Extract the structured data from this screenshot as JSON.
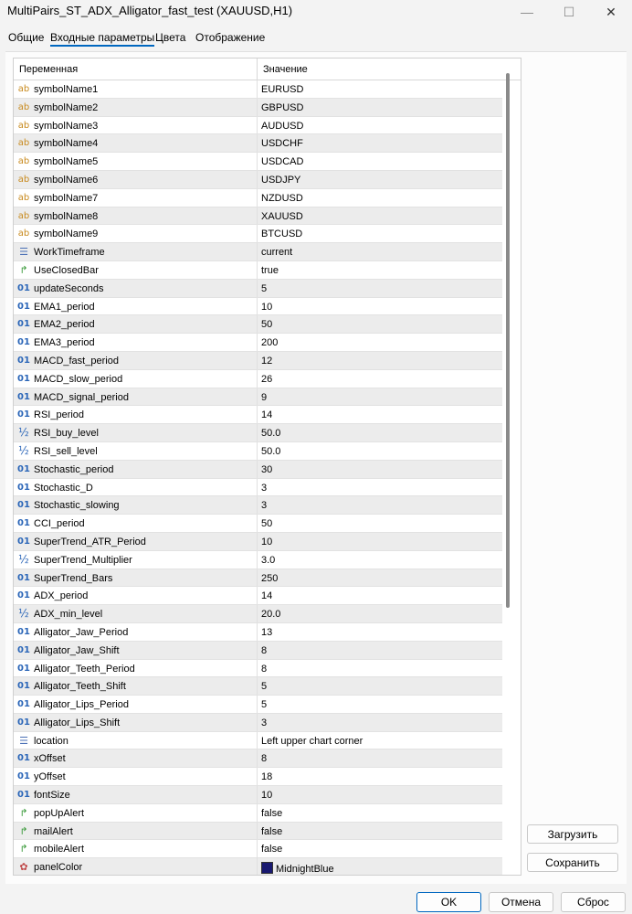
{
  "window": {
    "title": "MultiPairs_ST_ADX_Alligator_fast_test (XAUUSD,H1)",
    "minimize_glyph": "—",
    "maximize_glyph": "☐",
    "close_glyph": "✕"
  },
  "tabs": [
    {
      "label": "Общие"
    },
    {
      "label": "Входные параметры"
    },
    {
      "label": "Цвета"
    },
    {
      "label": "Отображение"
    }
  ],
  "table": {
    "col_variable": "Переменная",
    "col_value": "Значение",
    "rows": [
      {
        "icon": "ab",
        "name": "symbolName1",
        "value": "EURUSD"
      },
      {
        "icon": "ab",
        "name": "symbolName2",
        "value": "GBPUSD"
      },
      {
        "icon": "ab",
        "name": "symbolName3",
        "value": "AUDUSD"
      },
      {
        "icon": "ab",
        "name": "symbolName4",
        "value": "USDCHF"
      },
      {
        "icon": "ab",
        "name": "symbolName5",
        "value": "USDCAD"
      },
      {
        "icon": "ab",
        "name": "symbolName6",
        "value": "USDJPY"
      },
      {
        "icon": "ab",
        "name": "symbolName7",
        "value": "NZDUSD"
      },
      {
        "icon": "ab",
        "name": "symbolName8",
        "value": "XAUUSD"
      },
      {
        "icon": "ab",
        "name": "symbolName9",
        "value": "BTCUSD"
      },
      {
        "icon": "enum",
        "name": "WorkTimeframe",
        "value": "current"
      },
      {
        "icon": "flag",
        "name": "UseClosedBar",
        "value": "true"
      },
      {
        "icon": "num",
        "name": "updateSeconds",
        "value": "5"
      },
      {
        "icon": "num",
        "name": "EMA1_period",
        "value": "10"
      },
      {
        "icon": "num",
        "name": "EMA2_period",
        "value": "50"
      },
      {
        "icon": "num",
        "name": "EMA3_period",
        "value": "200"
      },
      {
        "icon": "num",
        "name": "MACD_fast_period",
        "value": "12"
      },
      {
        "icon": "num",
        "name": "MACD_slow_period",
        "value": "26"
      },
      {
        "icon": "num",
        "name": "MACD_signal_period",
        "value": "9"
      },
      {
        "icon": "num",
        "name": "RSI_period",
        "value": "14"
      },
      {
        "icon": "half",
        "name": "RSI_buy_level",
        "value": "50.0"
      },
      {
        "icon": "half",
        "name": "RSI_sell_level",
        "value": "50.0"
      },
      {
        "icon": "num",
        "name": "Stochastic_period",
        "value": "30"
      },
      {
        "icon": "num",
        "name": "Stochastic_D",
        "value": "3"
      },
      {
        "icon": "num",
        "name": "Stochastic_slowing",
        "value": "3"
      },
      {
        "icon": "num",
        "name": "CCI_period",
        "value": "50"
      },
      {
        "icon": "num",
        "name": "SuperTrend_ATR_Period",
        "value": "10"
      },
      {
        "icon": "half",
        "name": "SuperTrend_Multiplier",
        "value": "3.0"
      },
      {
        "icon": "num",
        "name": "SuperTrend_Bars",
        "value": "250"
      },
      {
        "icon": "num",
        "name": "ADX_period",
        "value": "14"
      },
      {
        "icon": "half",
        "name": "ADX_min_level",
        "value": "20.0"
      },
      {
        "icon": "num",
        "name": "Alligator_Jaw_Period",
        "value": "13"
      },
      {
        "icon": "num",
        "name": "Alligator_Jaw_Shift",
        "value": "8"
      },
      {
        "icon": "num",
        "name": "Alligator_Teeth_Period",
        "value": "8"
      },
      {
        "icon": "num",
        "name": "Alligator_Teeth_Shift",
        "value": "5"
      },
      {
        "icon": "num",
        "name": "Alligator_Lips_Period",
        "value": "5"
      },
      {
        "icon": "num",
        "name": "Alligator_Lips_Shift",
        "value": "3"
      },
      {
        "icon": "enum",
        "name": "location",
        "value": "Left upper chart corner"
      },
      {
        "icon": "num",
        "name": "xOffset",
        "value": "8"
      },
      {
        "icon": "num",
        "name": "yOffset",
        "value": "18"
      },
      {
        "icon": "num",
        "name": "fontSize",
        "value": "10"
      },
      {
        "icon": "flag",
        "name": "popUpAlert",
        "value": "false"
      },
      {
        "icon": "flag",
        "name": "mailAlert",
        "value": "false"
      },
      {
        "icon": "flag",
        "name": "mobileAlert",
        "value": "false"
      },
      {
        "icon": "color",
        "name": "panelColor",
        "value": "MidnightBlue",
        "swatch": "#191970"
      }
    ]
  },
  "icon_glyphs": {
    "ab": "ab",
    "num": "01",
    "half": "½",
    "flag": "↱",
    "enum": "☰",
    "color": "✿"
  },
  "side_buttons": {
    "load": "Загрузить",
    "save": "Сохранить"
  },
  "bottom_buttons": {
    "ok": "OK",
    "cancel": "Отмена",
    "reset": "Сброс"
  }
}
